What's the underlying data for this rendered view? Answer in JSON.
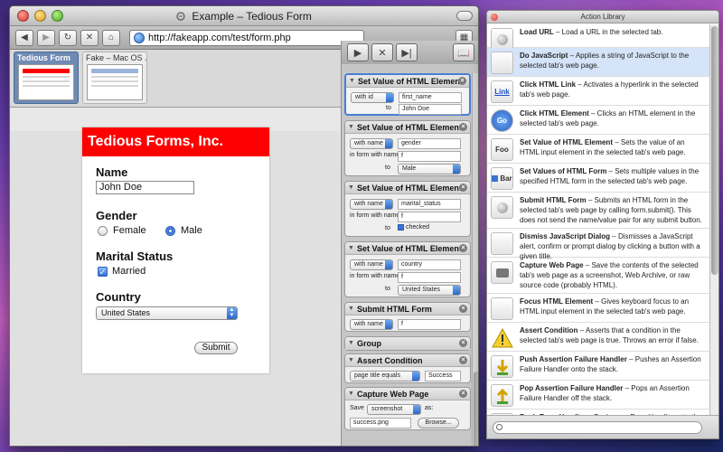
{
  "browser": {
    "title": "Example – Tedious Form",
    "url": "http://fakeapp.com/test/form.php",
    "tabs": [
      {
        "label": "Tedious Form"
      },
      {
        "label": "Fake – Mac OS ..."
      }
    ]
  },
  "form": {
    "header": "Tedious Forms, Inc.",
    "name_label": "Name",
    "name_value": "John Doe",
    "gender_label": "Gender",
    "gender_options": [
      "Female",
      "Male"
    ],
    "gender_selected": "Male",
    "marital_label": "Marital Status",
    "married_label": "Married",
    "married_checked": true,
    "country_label": "Country",
    "country_value": "United States",
    "submit_label": "Submit"
  },
  "actions": [
    {
      "title": "Set Value of HTML Element",
      "by": "with id",
      "value1": "first_name",
      "to_label": "to",
      "value2": "John Doe"
    },
    {
      "title": "Set Value of HTML Element",
      "by": "with name",
      "value1": "gender",
      "form_label": "in form with name",
      "form": "f",
      "to_label": "to",
      "value2": "Male"
    },
    {
      "title": "Set Value of HTML Element",
      "by": "with name",
      "value1": "marital_status",
      "form_label": "in form with name",
      "form": "f",
      "to_label": "to",
      "value2": "checked"
    },
    {
      "title": "Set Value of HTML Element",
      "by": "with name",
      "value1": "country",
      "form_label": "in form with name",
      "form": "f",
      "to_label": "to",
      "value2": "United States"
    },
    {
      "title": "Submit HTML Form",
      "by": "with name",
      "value1": "f"
    },
    {
      "title": "Group"
    },
    {
      "title": "Assert Condition",
      "by": "page title equals",
      "value1": "Success"
    },
    {
      "title": "Capture Web Page",
      "save_label": "Save",
      "save_type": "screenshot",
      "as_label": "as:",
      "filename": "success.png",
      "browse_label": "Browse..."
    }
  ],
  "library": {
    "title": "Action Library",
    "items": [
      {
        "name": "Load URL",
        "desc": " – Load a URL in the selected tab.",
        "icon": "load-icon",
        "icon_text": ""
      },
      {
        "name": "Do JavaScript",
        "desc": " – Applies a string of JavaScript to the selected tab's web page.",
        "icon": "javascript-icon",
        "icon_text": ""
      },
      {
        "name": "Click HTML Link",
        "desc": " – Activates a hyperlink in the selected tab's web page.",
        "icon": "link-icon",
        "icon_text": "Link"
      },
      {
        "name": "Click HTML Element",
        "desc": " – Clicks an HTML element in the selected tab's web page.",
        "icon": "go-icon",
        "icon_text": "Go"
      },
      {
        "name": "Set Value of HTML Element",
        "desc": " – Sets the value of an HTML input element in the selected tab's web page.",
        "icon": "foo-icon",
        "icon_text": "Foo"
      },
      {
        "name": "Set Values of HTML Form",
        "desc": " – Sets multiple values in the specified HTML form in the selected tab's web page.",
        "icon": "checkbox-bar-icon",
        "icon_text": "Bar"
      },
      {
        "name": "Submit HTML Form",
        "desc": " – Submits an HTML form in the selected tab's web page by calling form.submit(). This does not send the name/value pair for any submit button.",
        "icon": "submit-icon",
        "icon_text": ""
      },
      {
        "name": "Dismiss JavaScript Dialog",
        "desc": " – Dismisses a JavaScript alert, confirm or prompt dialog by clicking a button with a given title.",
        "icon": "dialog-icon",
        "icon_text": ""
      },
      {
        "name": "Capture Web Page",
        "desc": " – Save the contents of the selected tab's web page as a screenshot, Web Archive, or raw source code (probably HTML).",
        "icon": "camera-icon",
        "icon_text": ""
      },
      {
        "name": "Focus HTML Element",
        "desc": " – Gives keyboard focus to an HTML input element in the selected tab's web page.",
        "icon": "focus-icon",
        "icon_text": ""
      },
      {
        "name": "Assert Condition",
        "desc": " – Asserts that a condition in the selected tab's web page is true. Throws an error if false.",
        "icon": "warning-icon",
        "icon_text": ""
      },
      {
        "name": "Push Assertion Failure Handler",
        "desc": " – Pushes an Assertion Failure Handler onto the stack.",
        "icon": "push-icon",
        "icon_text": ""
      },
      {
        "name": "Pop Assertion Failure Handler",
        "desc": " – Pops an Assertion Failure Handler off the stack.",
        "icon": "pop-icon",
        "icon_text": ""
      },
      {
        "name": "Push Error Handler",
        "desc": " – Pushes an Error Handler onto the stack.",
        "icon": "push-error-icon",
        "icon_text": ""
      }
    ]
  }
}
